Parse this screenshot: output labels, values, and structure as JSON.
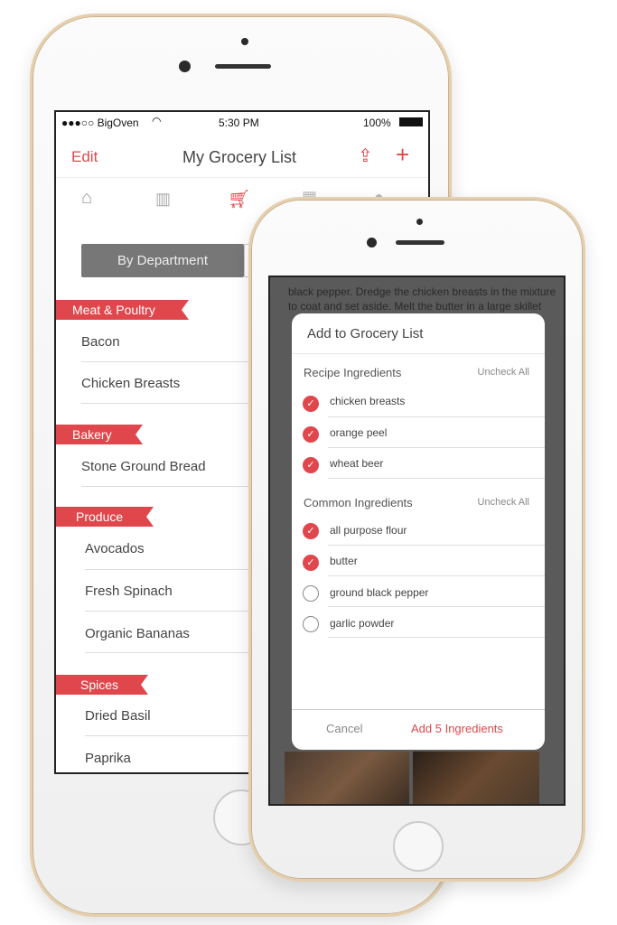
{
  "left_phone": {
    "status": {
      "carrier": "●●●○○ BigOven",
      "wifi_icon": "wifi-icon",
      "time": "5:30 PM",
      "battery": "100%"
    },
    "nav": {
      "edit": "Edit",
      "title": "My Grocery List",
      "share_icon": "share-icon",
      "add_icon": "plus-icon"
    },
    "tabs": [
      "home-icon",
      "book-icon",
      "cart-icon",
      "calendar-icon",
      "chef-hat-icon"
    ],
    "segment": {
      "selected": "By Department"
    },
    "sections": [
      {
        "name": "Meat & Poultry",
        "items": [
          "Bacon",
          "Chicken Breasts"
        ]
      },
      {
        "name": "Bakery",
        "items": [
          "Stone Ground Bread"
        ]
      },
      {
        "name": "Produce",
        "items": [
          "Avocados",
          "Fresh Spinach",
          "Organic Bananas"
        ]
      },
      {
        "name": "Spices",
        "items": [
          "Dried Basil",
          "Paprika"
        ]
      }
    ]
  },
  "right_phone": {
    "background_text": [
      "black pepper. Dredge the chicken breasts in the mixture",
      "to coat and set aside. Melt the butter in a large skillet"
    ],
    "dialog": {
      "title": "Add to Grocery List",
      "recipe": {
        "header": "Recipe Ingredients",
        "uncheck": "Uncheck All",
        "items": [
          {
            "name": "chicken breasts",
            "checked": true
          },
          {
            "name": "orange peel",
            "checked": true
          },
          {
            "name": "wheat beer",
            "checked": true
          }
        ]
      },
      "common": {
        "header": "Common Ingredients",
        "uncheck": "Uncheck All",
        "items": [
          {
            "name": "all purpose flour",
            "checked": true
          },
          {
            "name": "butter",
            "checked": true
          },
          {
            "name": "ground black pepper",
            "checked": false
          },
          {
            "name": "garlic powder",
            "checked": false
          }
        ]
      },
      "cancel": "Cancel",
      "confirm": "Add 5 Ingredients"
    }
  },
  "colors": {
    "accent": "#e0474c",
    "phone_trim": "#e4cfae"
  }
}
